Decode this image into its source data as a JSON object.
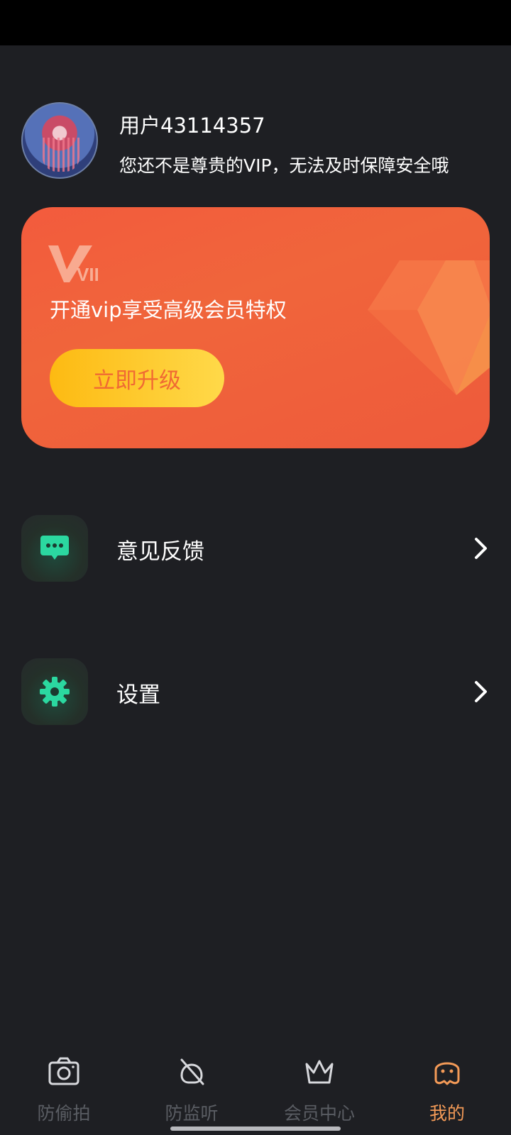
{
  "profile": {
    "username": "用户43114357",
    "subtitle": "您还不是尊贵的VIP，无法及时保障安全哦"
  },
  "vip_card": {
    "logo_text": "VIP",
    "promo_text": "开通vip享受高级会员特权",
    "upgrade_label": "立即升级"
  },
  "menu": {
    "items": [
      {
        "label": "意见反馈",
        "icon": "chat-bubble-icon"
      },
      {
        "label": "设置",
        "icon": "gear-icon"
      }
    ]
  },
  "tabs": [
    {
      "label": "防偷拍",
      "icon": "camera-icon",
      "active": false
    },
    {
      "label": "防监听",
      "icon": "no-listen-icon",
      "active": false
    },
    {
      "label": "会员中心",
      "icon": "crown-icon",
      "active": false
    },
    {
      "label": "我的",
      "icon": "ghost-face-icon",
      "active": true
    }
  ],
  "colors": {
    "background": "#1e1f23",
    "vip_card": "#f05c3c",
    "upgrade_button": "#fdc21e",
    "accent_active": "#f39a57",
    "icon_green": "#2bd8a0"
  }
}
